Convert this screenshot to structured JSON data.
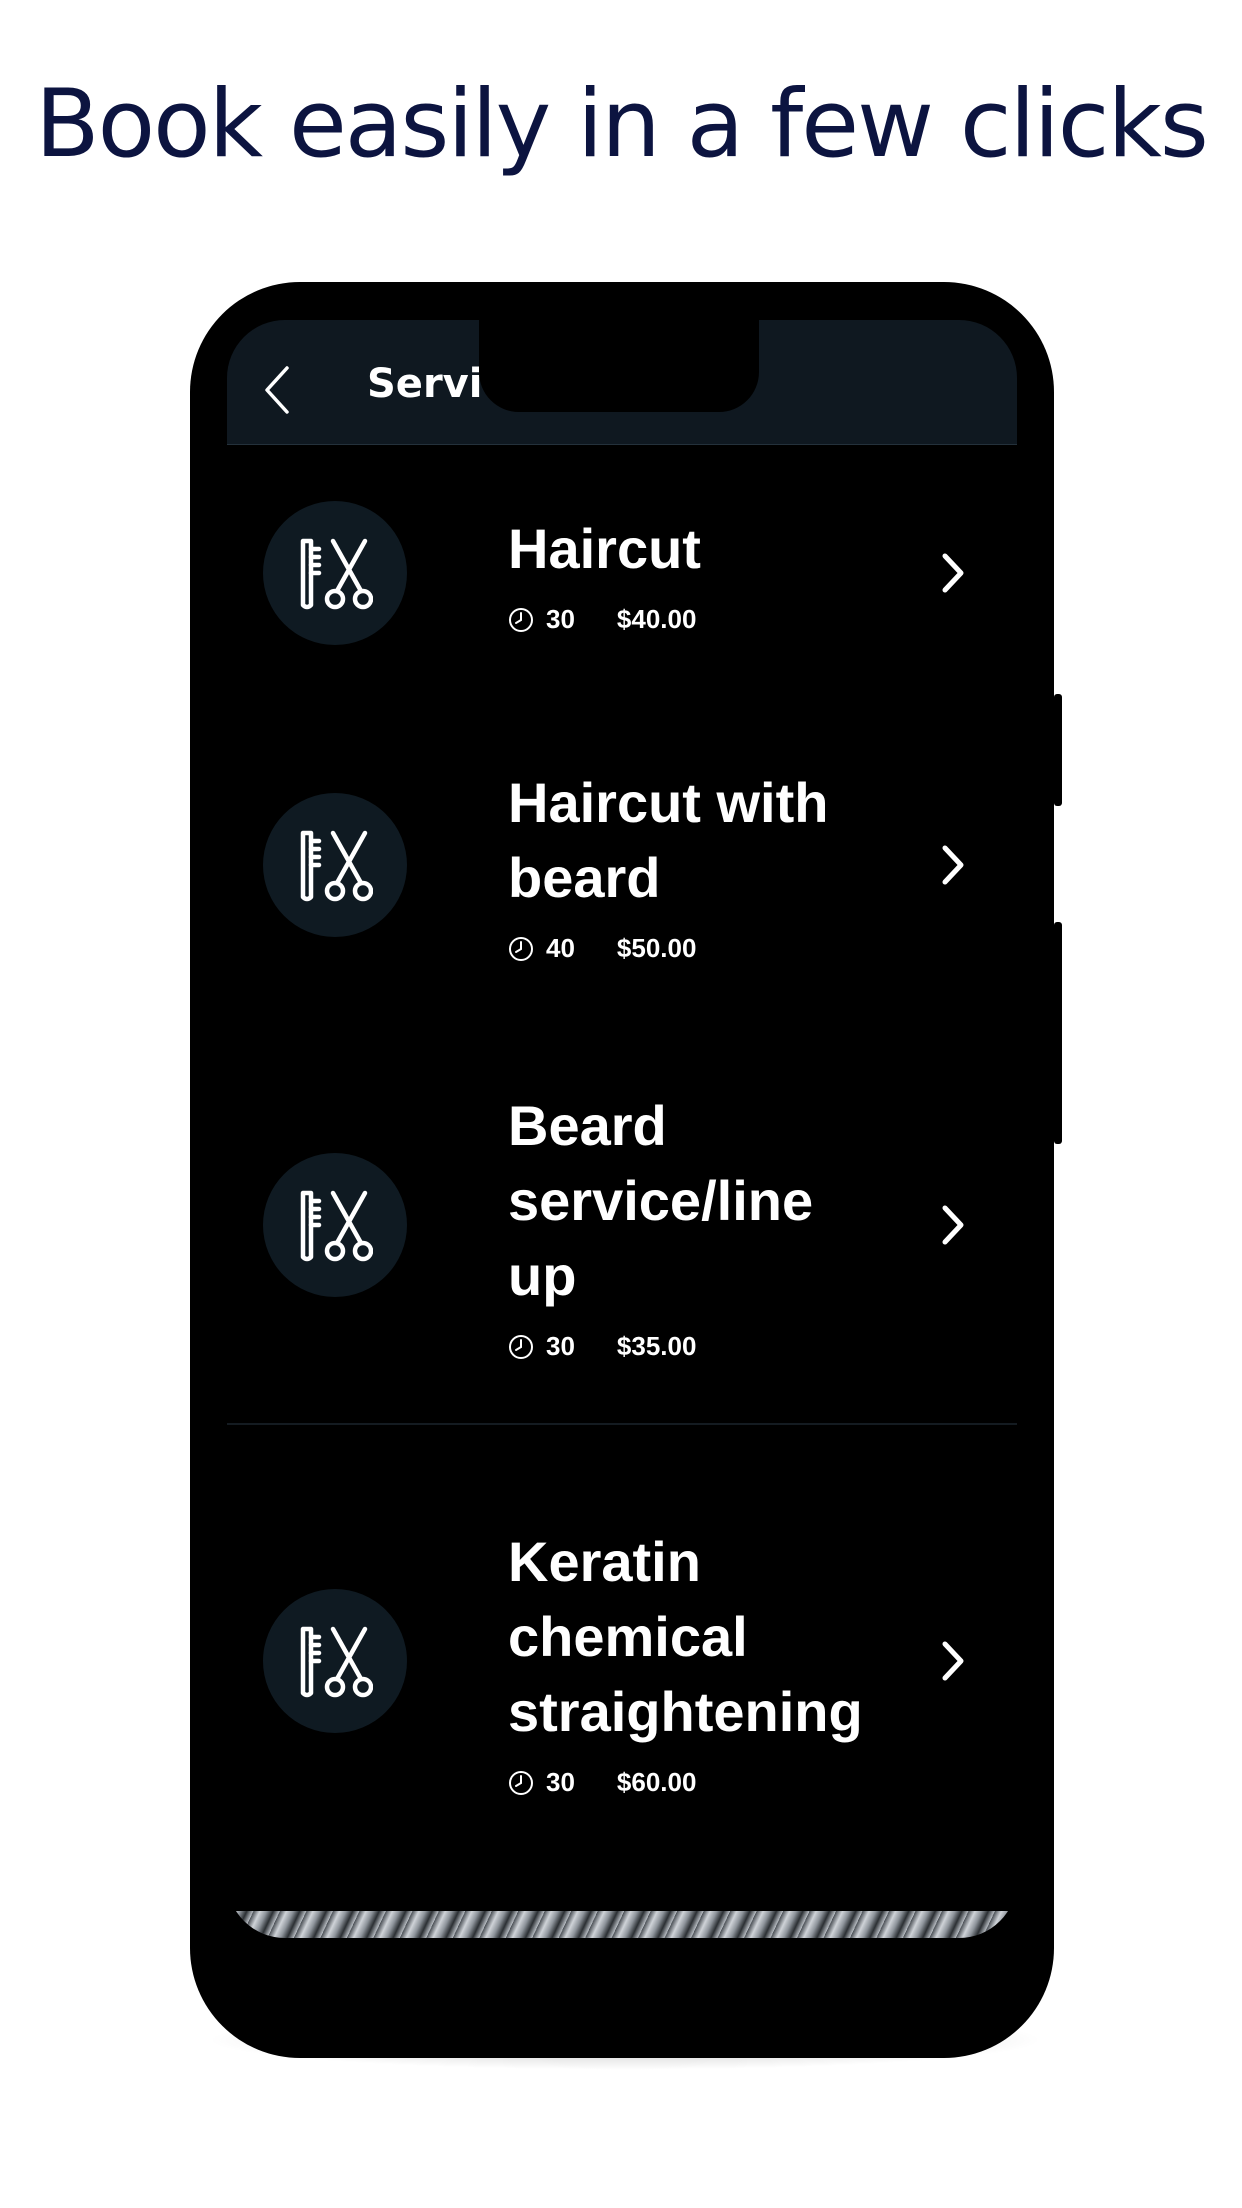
{
  "headline": "Book easily in a few clicks",
  "app": {
    "nav_title": "Servic",
    "services": [
      {
        "name": "Haircut",
        "duration": "30",
        "price": "$40.00",
        "icon": "comb-scissors-icon"
      },
      {
        "name": "Haircut with beard",
        "duration": "40",
        "price": "$50.00",
        "icon": "comb-scissors-icon"
      },
      {
        "name": "Beard service/line up",
        "duration": "30",
        "price": "$35.00",
        "icon": "comb-scissors-icon"
      },
      {
        "name": "Keratin chemical straightening",
        "duration": "30",
        "price": "$60.00",
        "icon": "comb-scissors-icon"
      }
    ]
  },
  "colors": {
    "headline": "#0c1440",
    "header_bg": "#0f1820",
    "icon_circle": "#0f1a22",
    "text": "#ffffff"
  }
}
